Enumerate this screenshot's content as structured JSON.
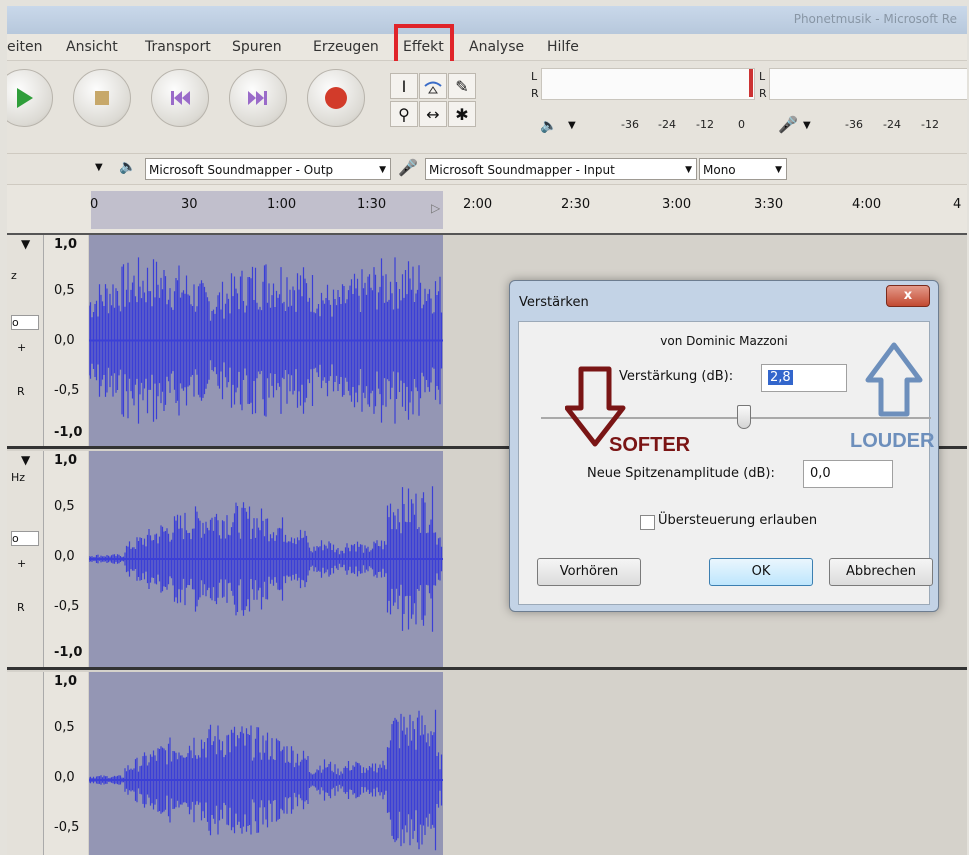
{
  "window": {
    "title": "Phonetmusik - Microsoft Re"
  },
  "menu": [
    "eiten",
    "Ansicht",
    "Transport",
    "Spuren",
    "Erzeugen",
    "Effekt",
    "Analyse",
    "Hilfe"
  ],
  "meters": {
    "playback": {
      "left": "L",
      "right": "R",
      "ticks": [
        "-36",
        "-24",
        "-12",
        "0"
      ]
    },
    "record": {
      "left": "L",
      "right": "R",
      "ticks": [
        "-36",
        "-24",
        "-12"
      ]
    }
  },
  "devices": {
    "output": "Microsoft Soundmapper - Outp",
    "input": "Microsoft Soundmapper - Input",
    "channels": "Mono"
  },
  "ruler": {
    "ticks": [
      "0",
      "30",
      "1:00",
      "1:30",
      "2:00",
      "2:30",
      "3:00",
      "3:30",
      "4:00",
      "4"
    ]
  },
  "tracks": [
    {
      "scale": [
        "1,0",
        "0,5",
        "0,0",
        "-0,5",
        "-1,0"
      ],
      "side": [
        "z",
        "o",
        "+",
        "R"
      ]
    },
    {
      "scale": [
        "1,0",
        "0,5",
        "0,0",
        "-0,5",
        "-1,0"
      ],
      "side": [
        "Hz",
        "o",
        "+",
        "R"
      ]
    },
    {
      "scale": [
        "1,0",
        "0,5",
        "0,0",
        "-0,5"
      ],
      "side": []
    }
  ],
  "dialog": {
    "title": "Verstärken",
    "close": "x",
    "author": "von Dominic Mazzoni",
    "gain_label": "Verstärkung (dB):",
    "gain_value": "2,8",
    "peak_label": "Neue Spitzenamplitude (dB):",
    "peak_value": "0,0",
    "clip_label": "Übersteuerung erlauben",
    "clip_checked": false,
    "slider_level": 0.52,
    "preview": "Vorhören",
    "ok": "OK",
    "cancel": "Abbrechen"
  },
  "annotations": {
    "softer": "SOFTER",
    "louder": "LOUDER"
  },
  "colors": {
    "wave": "#3b3fd6",
    "selection": "#9496b4",
    "highlight": "#e0242a",
    "softer": "#7a1515",
    "louder": "#6d8fbc"
  }
}
